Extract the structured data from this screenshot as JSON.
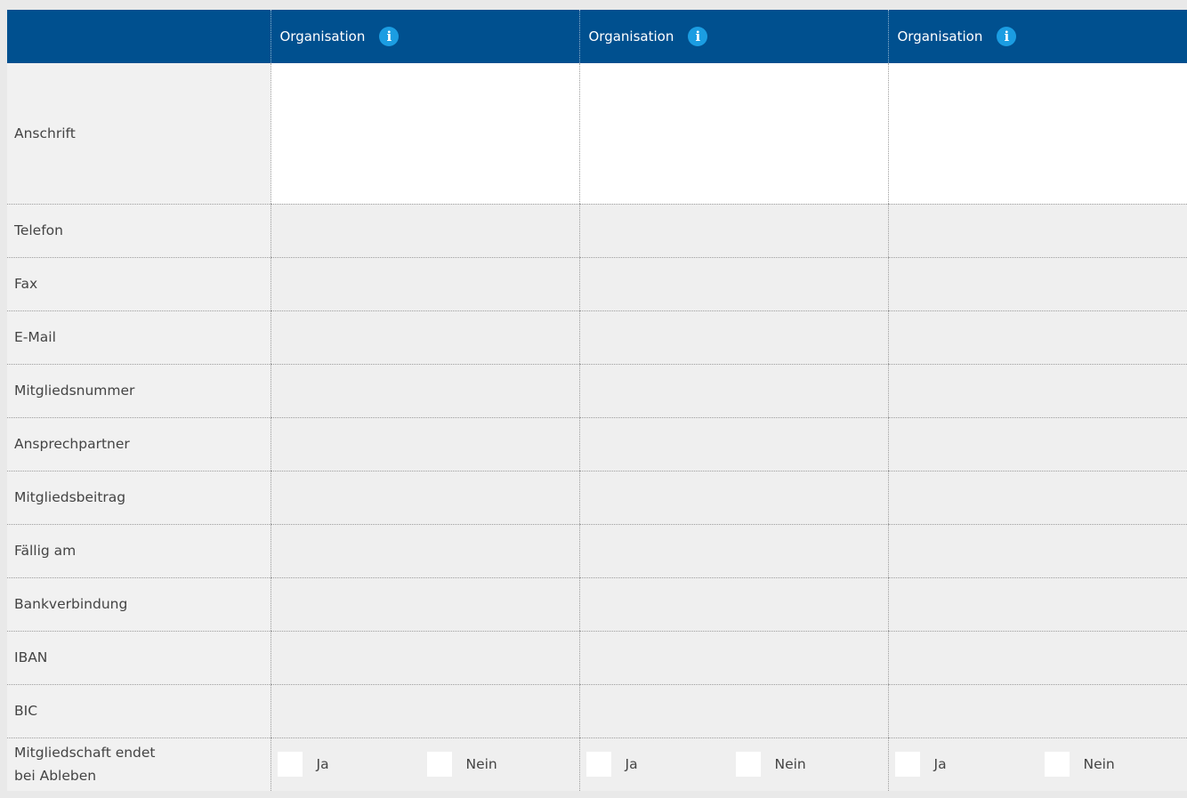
{
  "header": {
    "columns": [
      {
        "title": "Organisation",
        "icon": "info-icon"
      },
      {
        "title": "Organisation",
        "icon": "info-icon"
      },
      {
        "title": "Organisation",
        "icon": "info-icon"
      }
    ]
  },
  "rows": [
    {
      "label": "Anschrift"
    },
    {
      "label": "Telefon"
    },
    {
      "label": "Fax"
    },
    {
      "label": "E-Mail"
    },
    {
      "label": "Mitgliedsnummer"
    },
    {
      "label": "Ansprechpartner"
    },
    {
      "label": "Mitgliedsbeitrag"
    },
    {
      "label": "Fällig am"
    },
    {
      "label": "Bankverbindung"
    },
    {
      "label": "IBAN"
    },
    {
      "label": "BIC"
    }
  ],
  "last_row": {
    "label_line1": "Mitgliedschaft endet",
    "label_line2": "bei Ableben",
    "yes_label": "Ja",
    "no_label": "Nein"
  },
  "colors": {
    "header_bg": "#00508f",
    "info_icon": "#1b9de2",
    "label_bg": "#f1f1f1",
    "field_bg": "#efefef"
  }
}
